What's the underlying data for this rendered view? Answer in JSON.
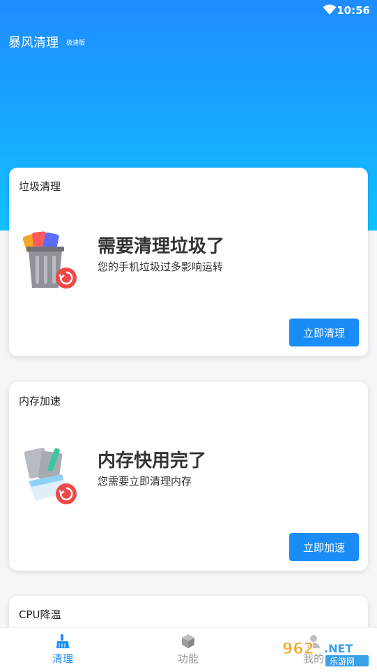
{
  "status": {
    "time": "10:56"
  },
  "app": {
    "title": "暴风清理",
    "subtitle": "极速版"
  },
  "cards": [
    {
      "title": "垃圾清理",
      "headline": "需要清理垃圾了",
      "desc": "您的手机垃圾过多影响运转",
      "button": "立即清理"
    },
    {
      "title": "内存加速",
      "headline": "内存快用完了",
      "desc": "您需要立即清理内存",
      "button": "立即加速"
    },
    {
      "title": "CPU降温"
    }
  ],
  "nav": [
    {
      "label": "清理",
      "icon": "broom-icon",
      "active": true
    },
    {
      "label": "功能",
      "icon": "cube-icon",
      "active": false
    },
    {
      "label": "我的",
      "icon": "user-icon",
      "active": false
    }
  ],
  "watermark": {
    "text": "962.NET",
    "sub": "乐游网"
  },
  "colors": {
    "accent": "#1a8cf6",
    "gradient_top": "#1f8cff",
    "gradient_bottom": "#12c2ff",
    "badge": "#f04848"
  }
}
